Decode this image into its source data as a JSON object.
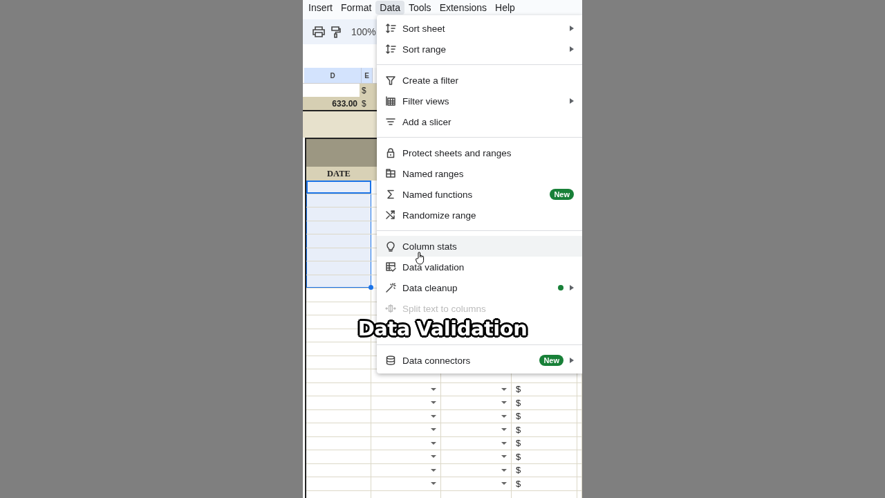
{
  "menu_bar": [
    {
      "label": "Insert",
      "selected": false
    },
    {
      "label": "Format",
      "selected": false
    },
    {
      "label": "Data",
      "selected": true
    },
    {
      "label": "Tools",
      "selected": false
    },
    {
      "label": "Extensions",
      "selected": false
    },
    {
      "label": "Help",
      "selected": false
    }
  ],
  "toolbar": {
    "zoom": "100%"
  },
  "sheet": {
    "column_headers": [
      "D",
      "E"
    ],
    "summary_rows": [
      {
        "currency": "$"
      },
      {
        "amount": "633.00",
        "currency": "$"
      }
    ],
    "table_header": "DATE",
    "rows": [
      {
        "selected": true
      },
      {
        "selected": true
      },
      {
        "selected": true
      },
      {
        "selected": true
      },
      {
        "selected": true
      },
      {
        "selected": true
      },
      {
        "selected": true
      },
      {
        "selected": true
      },
      {
        "selected": false
      },
      {
        "selected": false
      },
      {
        "selected": false
      },
      {
        "selected": false
      },
      {
        "selected": false
      },
      {
        "selected": false
      },
      {
        "selected": false
      },
      {
        "selected": false,
        "cells": [
          {
            "kind": "dropdown"
          },
          {
            "kind": "dropdown"
          },
          {
            "kind": "text",
            "text": "$"
          }
        ]
      },
      {
        "selected": false,
        "cells": [
          {
            "kind": "dropdown"
          },
          {
            "kind": "dropdown"
          },
          {
            "kind": "text",
            "text": "$"
          }
        ]
      },
      {
        "selected": false,
        "cells": [
          {
            "kind": "dropdown"
          },
          {
            "kind": "dropdown"
          },
          {
            "kind": "text",
            "text": "$"
          }
        ]
      },
      {
        "selected": false,
        "cells": [
          {
            "kind": "dropdown"
          },
          {
            "kind": "dropdown"
          },
          {
            "kind": "text",
            "text": "$"
          }
        ]
      },
      {
        "selected": false,
        "cells": [
          {
            "kind": "dropdown"
          },
          {
            "kind": "dropdown"
          },
          {
            "kind": "text",
            "text": "$"
          }
        ]
      },
      {
        "selected": false,
        "cells": [
          {
            "kind": "dropdown"
          },
          {
            "kind": "dropdown"
          },
          {
            "kind": "text",
            "text": "$"
          }
        ]
      },
      {
        "selected": false,
        "cells": [
          {
            "kind": "dropdown"
          },
          {
            "kind": "dropdown"
          },
          {
            "kind": "text",
            "text": "$"
          }
        ]
      },
      {
        "selected": false,
        "cells": [
          {
            "kind": "dropdown"
          },
          {
            "kind": "dropdown"
          },
          {
            "kind": "text",
            "text": "$"
          }
        ]
      },
      {
        "selected": false
      }
    ]
  },
  "menu": {
    "sections": [
      [
        {
          "kind": "item",
          "label": "Sort sheet",
          "submenu": true,
          "highlighted": false,
          "disabled": false
        },
        {
          "kind": "item",
          "label": "Sort range",
          "submenu": true,
          "highlighted": false,
          "disabled": false
        }
      ],
      [
        {
          "kind": "item",
          "label": "Create a filter",
          "submenu": false,
          "highlighted": false,
          "disabled": false
        },
        {
          "kind": "item",
          "label": "Filter views",
          "submenu": true,
          "highlighted": false,
          "disabled": false
        },
        {
          "kind": "item",
          "label": "Add a slicer",
          "submenu": false,
          "highlighted": false,
          "disabled": false
        }
      ],
      [
        {
          "kind": "item",
          "label": "Protect sheets and ranges",
          "submenu": false,
          "highlighted": false,
          "disabled": false
        },
        {
          "kind": "item",
          "label": "Named ranges",
          "submenu": false,
          "highlighted": false,
          "disabled": false
        },
        {
          "kind": "item",
          "label": "Named functions",
          "submenu": false,
          "highlighted": false,
          "disabled": false,
          "badge": "New"
        },
        {
          "kind": "item",
          "label": "Randomize range",
          "submenu": false,
          "highlighted": false,
          "disabled": false
        }
      ],
      [
        {
          "kind": "item",
          "label": "Column stats",
          "submenu": false,
          "highlighted": true,
          "disabled": false
        },
        {
          "kind": "item",
          "label": "Data validation",
          "submenu": false,
          "highlighted": false,
          "disabled": false
        },
        {
          "kind": "item",
          "label": "Data cleanup",
          "submenu": true,
          "highlighted": false,
          "disabled": false,
          "dot": true
        },
        {
          "kind": "item",
          "label": "Split text to columns",
          "submenu": false,
          "highlighted": false,
          "disabled": true
        },
        {
          "kind": "covered"
        }
      ],
      [
        {
          "kind": "item",
          "label": "Data connectors",
          "submenu": true,
          "highlighted": false,
          "disabled": false,
          "badge": "New"
        }
      ]
    ]
  },
  "caption": "Data Validation"
}
